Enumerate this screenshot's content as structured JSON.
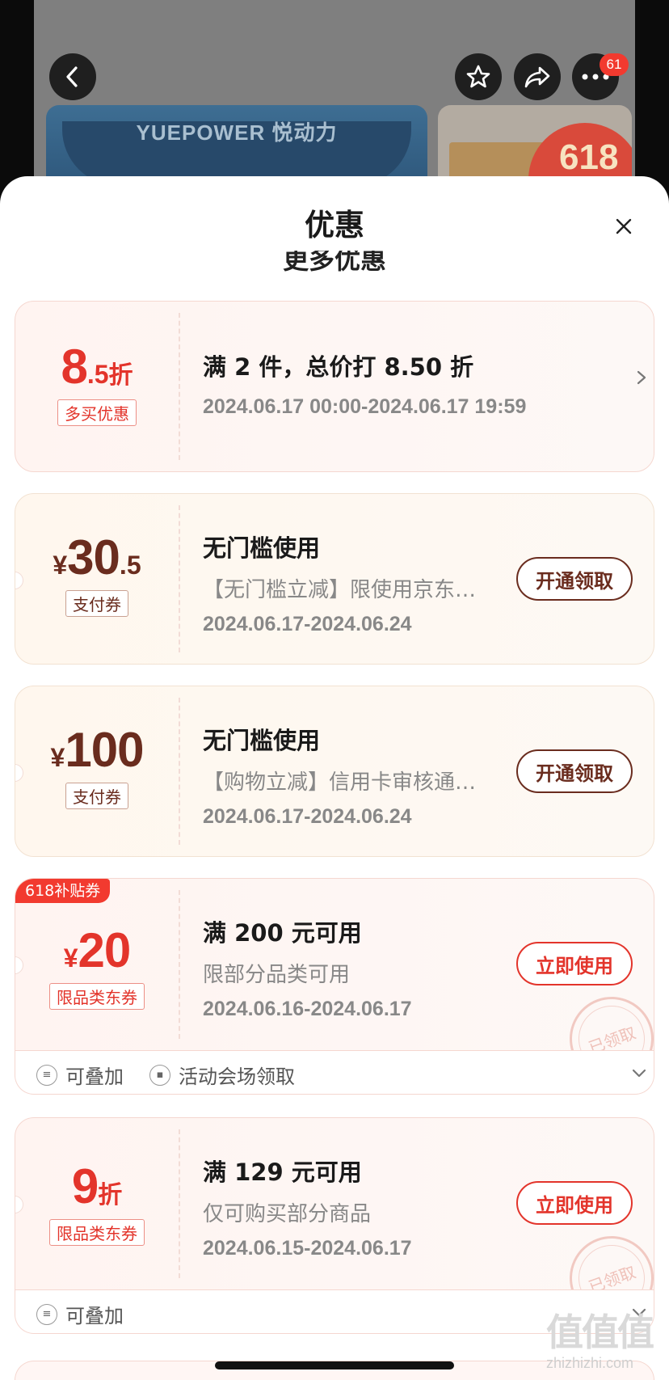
{
  "background": {
    "banner_text": "YUEPOWER 悦动力",
    "side_card_text": "618",
    "more_badge": "61"
  },
  "sheet": {
    "title": "优惠",
    "section_label": "更多优惠"
  },
  "coupons": [
    {
      "amount_main": "8",
      "amount_small": ".5",
      "amount_suffix": "折",
      "tag": "多买优惠",
      "title": "满 2 件，总价打 8.50 折",
      "date": "2024.06.17 00:00-2024.06.17 19:59"
    },
    {
      "currency": "¥",
      "amount_main": "30",
      "amount_small": ".5",
      "tag": "支付券",
      "title": "无门槛使用",
      "desc": "【无门槛立减】限使用京东…",
      "date": "2024.06.17-2024.06.24",
      "button": "开通领取"
    },
    {
      "currency": "¥",
      "amount_main": "100",
      "tag": "支付券",
      "title": "无门槛使用",
      "desc": "【购物立减】信用卡审核通…",
      "date": "2024.06.17-2024.06.24",
      "button": "开通领取"
    },
    {
      "ribbon": "618补贴券",
      "currency": "¥",
      "amount_main": "20",
      "tag": "限品类东券",
      "title": "满 200 元可用",
      "desc": "限部分品类可用",
      "date": "2024.06.16-2024.06.17",
      "button": "立即使用",
      "stamp": "已领取",
      "footer_stackable": "可叠加",
      "footer_source": "活动会场领取"
    },
    {
      "amount_main": "9",
      "amount_suffix": "折",
      "tag": "限品类东券",
      "title": "满 129 元可用",
      "desc": "仅可购买部分商品",
      "date": "2024.06.15-2024.06.17",
      "button": "立即使用",
      "stamp": "已领取",
      "footer_stackable": "可叠加"
    }
  ],
  "watermark": {
    "logo": "值值值",
    "url": "zhizhizhi.com"
  },
  "colors": {
    "accent_red": "#e3342b",
    "accent_brown": "#6a2c1e",
    "badge_red": "#f23a2f"
  },
  "icons": [
    "back-arrow-icon",
    "star-icon",
    "share-icon",
    "more-icon",
    "close-icon",
    "chevron-right-icon",
    "chevron-down-icon",
    "stack-icon",
    "ticket-icon"
  ]
}
